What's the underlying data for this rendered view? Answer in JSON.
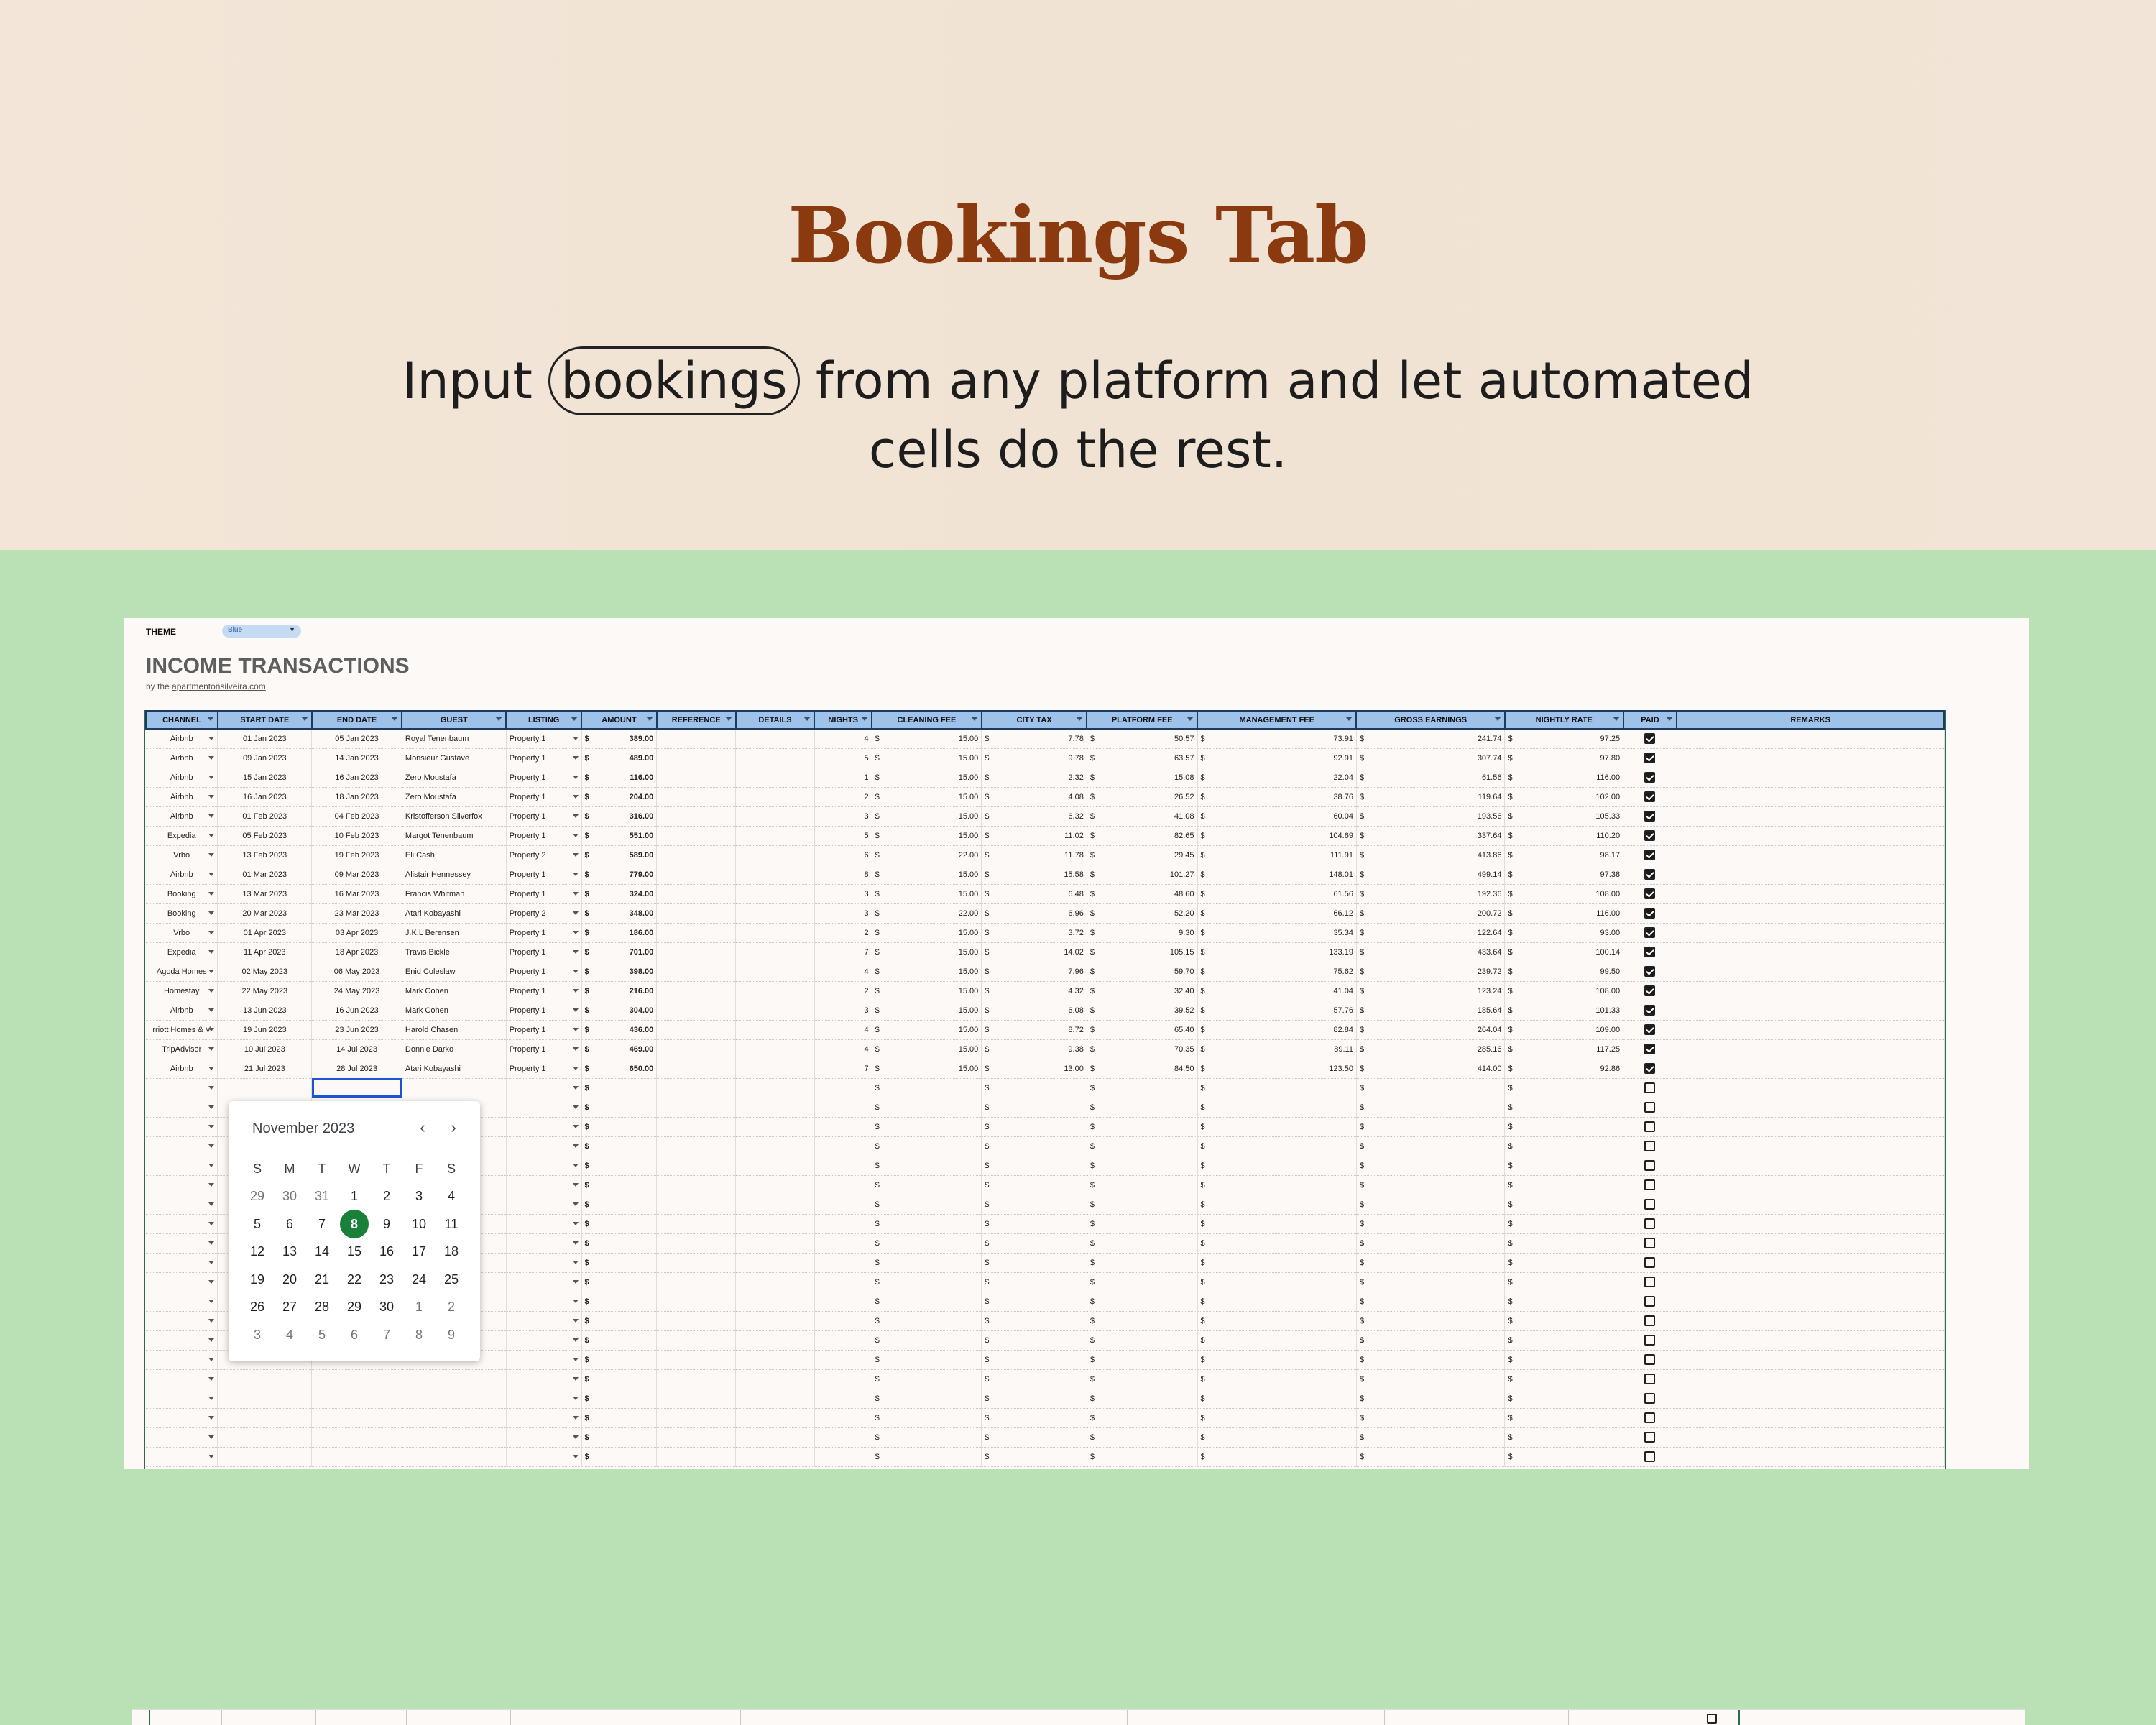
{
  "hero": {
    "title": "Bookings Tab",
    "subtitle_before": "Input",
    "subtitle_highlight": "bookings",
    "subtitle_after": "from any platform and let automated",
    "subtitle_line2": "cells do the rest."
  },
  "sheet": {
    "theme_label": "THEME",
    "theme_value": "Blue",
    "title": "INCOME TRANSACTIONS",
    "byline_prefix": "by the",
    "byline_link": "apartmentonsilveira.com",
    "columns": [
      "CHANNEL",
      "START DATE",
      "END DATE",
      "GUEST",
      "LISTING",
      "AMOUNT",
      "REFERENCE",
      "DETAILS",
      "NIGHTS",
      "CLEANING FEE",
      "CITY TAX",
      "PLATFORM FEE",
      "MANAGEMENT FEE",
      "GROSS EARNINGS",
      "NIGHTLY RATE",
      "PAID",
      "REMARKS"
    ],
    "currency": "$",
    "rows": [
      [
        "Airbnb",
        "01 Jan 2023",
        "05 Jan 2023",
        "Royal Tenenbaum",
        "Property 1",
        "389.00",
        "",
        "",
        "4",
        "15.00",
        "7.78",
        "50.57",
        "73.91",
        "241.74",
        "97.25",
        true
      ],
      [
        "Airbnb",
        "09 Jan 2023",
        "14 Jan 2023",
        "Monsieur Gustave",
        "Property 1",
        "489.00",
        "",
        "",
        "5",
        "15.00",
        "9.78",
        "63.57",
        "92.91",
        "307.74",
        "97.80",
        true
      ],
      [
        "Airbnb",
        "15 Jan 2023",
        "16 Jan 2023",
        "Zero Moustafa",
        "Property 1",
        "116.00",
        "",
        "",
        "1",
        "15.00",
        "2.32",
        "15.08",
        "22.04",
        "61.56",
        "116.00",
        true
      ],
      [
        "Airbnb",
        "16 Jan 2023",
        "18 Jan 2023",
        "Zero Moustafa",
        "Property 1",
        "204.00",
        "",
        "",
        "2",
        "15.00",
        "4.08",
        "26.52",
        "38.76",
        "119.64",
        "102.00",
        true
      ],
      [
        "Airbnb",
        "01 Feb 2023",
        "04 Feb 2023",
        "Kristofferson Silverfox",
        "Property 1",
        "316.00",
        "",
        "",
        "3",
        "15.00",
        "6.32",
        "41.08",
        "60.04",
        "193.56",
        "105.33",
        true
      ],
      [
        "Expedia",
        "05 Feb 2023",
        "10 Feb 2023",
        "Margot Tenenbaum",
        "Property 1",
        "551.00",
        "",
        "",
        "5",
        "15.00",
        "11.02",
        "82.65",
        "104.69",
        "337.64",
        "110.20",
        true
      ],
      [
        "Vrbo",
        "13 Feb 2023",
        "19 Feb 2023",
        "Eli Cash",
        "Property 2",
        "589.00",
        "",
        "",
        "6",
        "22.00",
        "11.78",
        "29.45",
        "111.91",
        "413.86",
        "98.17",
        true
      ],
      [
        "Airbnb",
        "01 Mar 2023",
        "09 Mar 2023",
        "Alistair Hennessey",
        "Property 1",
        "779.00",
        "",
        "",
        "8",
        "15.00",
        "15.58",
        "101.27",
        "148.01",
        "499.14",
        "97.38",
        true
      ],
      [
        "Booking",
        "13 Mar 2023",
        "16 Mar 2023",
        "Francis Whitman",
        "Property 1",
        "324.00",
        "",
        "",
        "3",
        "15.00",
        "6.48",
        "48.60",
        "61.56",
        "192.36",
        "108.00",
        true
      ],
      [
        "Booking",
        "20 Mar 2023",
        "23 Mar 2023",
        "Atari Kobayashi",
        "Property 2",
        "348.00",
        "",
        "",
        "3",
        "22.00",
        "6.96",
        "52.20",
        "66.12",
        "200.72",
        "116.00",
        true
      ],
      [
        "Vrbo",
        "01 Apr 2023",
        "03 Apr 2023",
        "J.K.L Berensen",
        "Property 1",
        "186.00",
        "",
        "",
        "2",
        "15.00",
        "3.72",
        "9.30",
        "35.34",
        "122.64",
        "93.00",
        true
      ],
      [
        "Expedia",
        "11 Apr 2023",
        "18 Apr 2023",
        "Travis Bickle",
        "Property 1",
        "701.00",
        "",
        "",
        "7",
        "15.00",
        "14.02",
        "105.15",
        "133.19",
        "433.64",
        "100.14",
        true
      ],
      [
        "Agoda Homes",
        "02 May 2023",
        "06 May 2023",
        "Enid Coleslaw",
        "Property 1",
        "398.00",
        "",
        "",
        "4",
        "15.00",
        "7.96",
        "59.70",
        "75.62",
        "239.72",
        "99.50",
        true
      ],
      [
        "Homestay",
        "22 May 2023",
        "24 May 2023",
        "Mark Cohen",
        "Property 1",
        "216.00",
        "",
        "",
        "2",
        "15.00",
        "4.32",
        "32.40",
        "41.04",
        "123.24",
        "108.00",
        true
      ],
      [
        "Airbnb",
        "13 Jun 2023",
        "16 Jun 2023",
        "Mark Cohen",
        "Property 1",
        "304.00",
        "",
        "",
        "3",
        "15.00",
        "6.08",
        "39.52",
        "57.76",
        "185.64",
        "101.33",
        true
      ],
      [
        "rriott Homes & V",
        "19 Jun 2023",
        "23 Jun 2023",
        "Harold Chasen",
        "Property 1",
        "436.00",
        "",
        "",
        "4",
        "15.00",
        "8.72",
        "65.40",
        "82.84",
        "264.04",
        "109.00",
        true
      ],
      [
        "TripAdvisor",
        "10 Jul 2023",
        "14 Jul 2023",
        "Donnie Darko",
        "Property 1",
        "469.00",
        "",
        "",
        "4",
        "15.00",
        "9.38",
        "70.35",
        "89.11",
        "285.16",
        "117.25",
        true
      ],
      [
        "Airbnb",
        "21 Jul 2023",
        "28 Jul 2023",
        "Atari Kobayashi",
        "Property 1",
        "650.00",
        "",
        "",
        "7",
        "15.00",
        "13.00",
        "84.50",
        "123.50",
        "414.00",
        "92.86",
        true
      ]
    ],
    "empty_row_count": 20
  },
  "picker": {
    "month": "November 2023",
    "prev_icon": "chevron-left-icon",
    "next_icon": "chevron-right-icon",
    "weekdays": [
      "S",
      "M",
      "T",
      "W",
      "T",
      "F",
      "S"
    ],
    "weeks": [
      [
        "29",
        "30",
        "31",
        "1",
        "2",
        "3",
        "4"
      ],
      [
        "5",
        "6",
        "7",
        "8",
        "9",
        "10",
        "11"
      ],
      [
        "12",
        "13",
        "14",
        "15",
        "16",
        "17",
        "18"
      ],
      [
        "19",
        "20",
        "21",
        "22",
        "23",
        "24",
        "25"
      ],
      [
        "26",
        "27",
        "28",
        "29",
        "30",
        "1",
        "2"
      ],
      [
        "3",
        "4",
        "5",
        "6",
        "7",
        "8",
        "9"
      ]
    ],
    "selected_day": "8",
    "accent": "#188038"
  },
  "colors": {
    "hero_title": "#8b3a10",
    "header_fill": "#9ec2ea",
    "background_green": "#bae1b5"
  }
}
